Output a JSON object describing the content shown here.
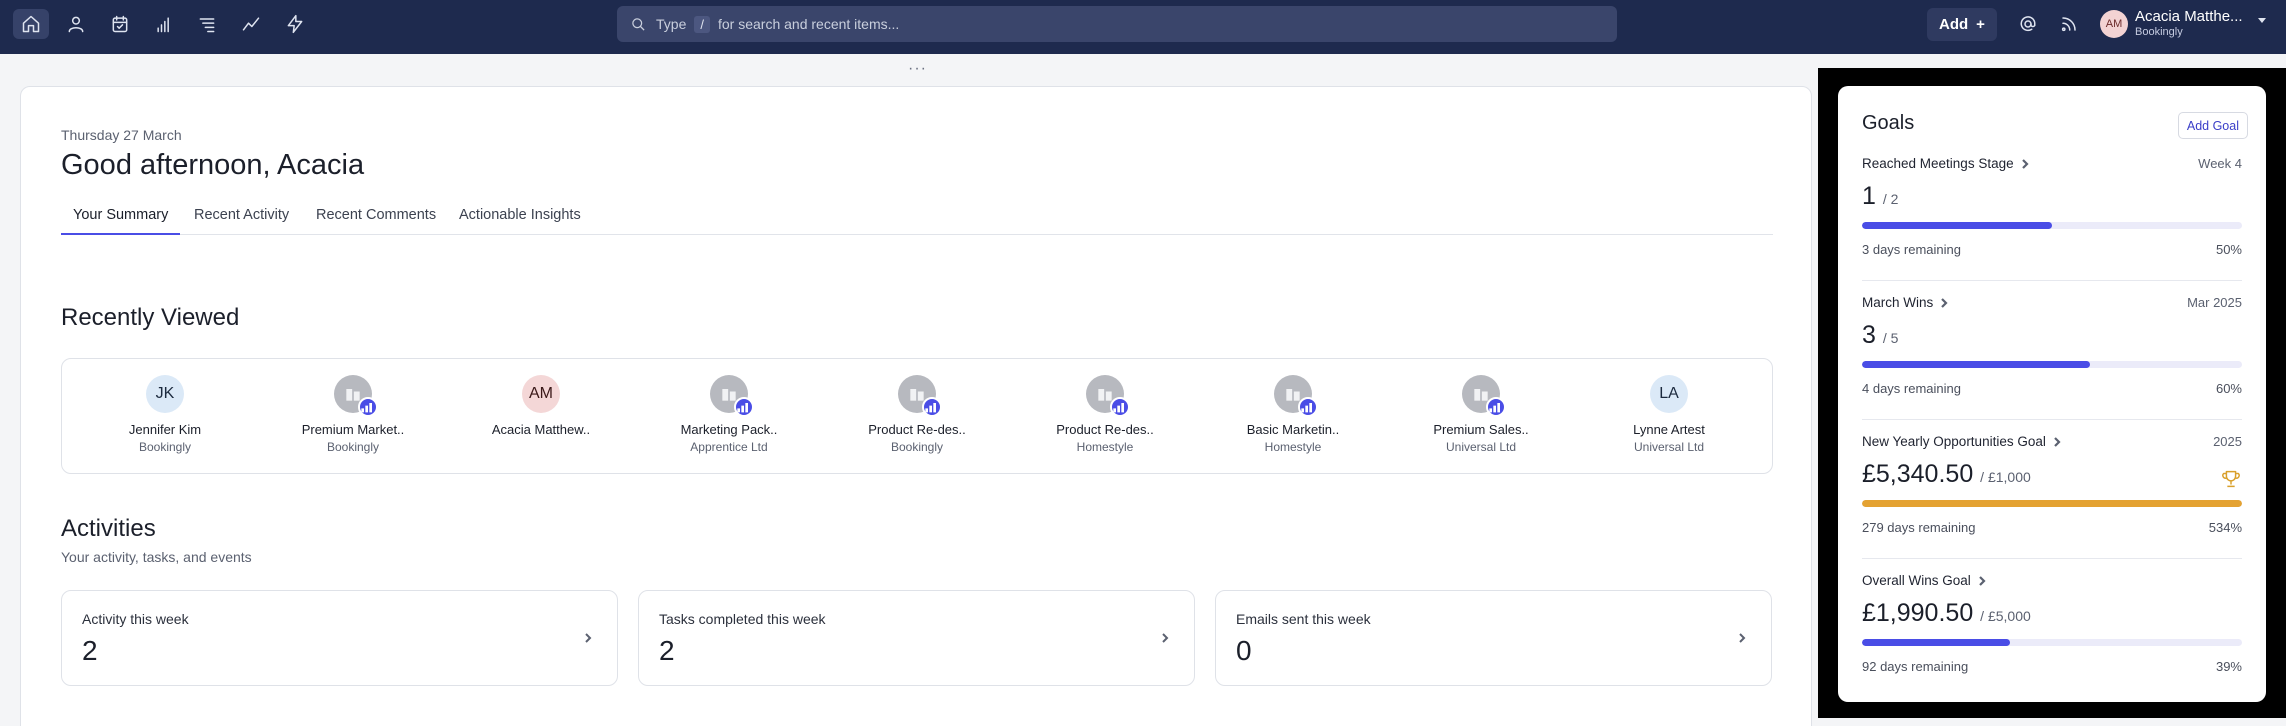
{
  "nav": {
    "icons": [
      "home-icon",
      "person-icon",
      "calendar-icon",
      "bar-chart-icon",
      "list-icon",
      "trend-icon",
      "lightning-icon"
    ]
  },
  "search": {
    "prefix": "Type",
    "key": "/",
    "suffix": "for search and recent items..."
  },
  "topbar": {
    "add_label": "Add",
    "user_initials": "AM",
    "user_name": "Acacia Matthe...",
    "user_org": "Bookingly"
  },
  "main": {
    "date": "Thursday 27 March",
    "greeting": "Good afternoon, Acacia",
    "tabs": [
      {
        "label": "Your Summary",
        "active": true
      },
      {
        "label": "Recent Activity"
      },
      {
        "label": "Recent Comments"
      },
      {
        "label": "Actionable Insights"
      }
    ],
    "recently_viewed_title": "Recently Viewed",
    "recently_viewed": [
      {
        "type": "person",
        "initials": "JK",
        "name": "Jennifer Kim",
        "org": "Bookingly"
      },
      {
        "type": "deal",
        "name": "Premium Market..",
        "org": "Bookingly"
      },
      {
        "type": "person",
        "initials": "AM",
        "name": "Acacia Matthew..",
        "org": ""
      },
      {
        "type": "deal",
        "name": "Marketing Pack..",
        "org": "Apprentice Ltd"
      },
      {
        "type": "deal",
        "name": "Product Re-des..",
        "org": "Bookingly"
      },
      {
        "type": "deal",
        "name": "Product Re-des..",
        "org": "Homestyle"
      },
      {
        "type": "deal",
        "name": "Basic Marketin..",
        "org": "Homestyle"
      },
      {
        "type": "deal",
        "name": "Premium Sales..",
        "org": "Universal Ltd"
      },
      {
        "type": "person",
        "initials": "LA",
        "name": "Lynne Artest",
        "org": "Universal Ltd"
      }
    ],
    "activities_title": "Activities",
    "activities_sub": "Your activity, tasks, and events",
    "stats": [
      {
        "label": "Activity this week",
        "value": "2"
      },
      {
        "label": "Tasks completed this week",
        "value": "2"
      },
      {
        "label": "Emails sent this week",
        "value": "0"
      }
    ]
  },
  "goals": {
    "title": "Goals",
    "add_label": "Add Goal",
    "items": [
      {
        "name": "Reached Meetings Stage",
        "period": "Week 4",
        "value": "1",
        "target": "/ 2",
        "remaining": "3 days remaining",
        "percent_label": "50%",
        "progress": 0.5,
        "color": "#4a4de6"
      },
      {
        "name": "March Wins",
        "period": "Mar 2025",
        "value": "3",
        "target": "/ 5",
        "remaining": "4 days remaining",
        "percent_label": "60%",
        "progress": 0.6,
        "color": "#4a4de6"
      },
      {
        "name": "New Yearly Opportunities Goal",
        "period": "2025",
        "value": "£5,340.50",
        "target": "/ £1,000",
        "remaining": "279 days remaining",
        "percent_label": "534%",
        "progress": 1.0,
        "color": "#e4a232",
        "achieved": true
      },
      {
        "name": "Overall Wins Goal",
        "period": "",
        "value": "£1,990.50",
        "target": "/ £5,000",
        "remaining": "92 days remaining",
        "percent_label": "39%",
        "progress": 0.39,
        "color": "#4a4de6"
      }
    ]
  }
}
